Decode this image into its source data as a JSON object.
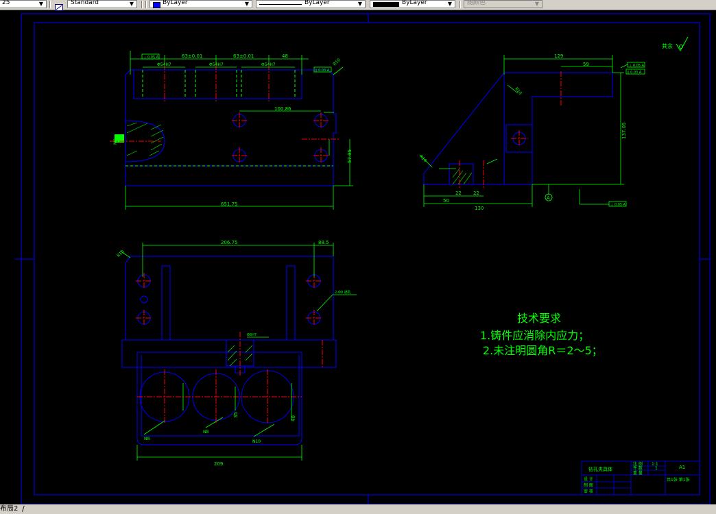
{
  "toolbar": {
    "lineweight_value": "25",
    "dimstyle_value": "Standard",
    "color_value": "ByLayer",
    "color_hex": "#0000ff",
    "linetype_value": "ByLayer",
    "lineweight2_value": "ByLayer",
    "plotstyle_value": "随颜色"
  },
  "drawing": {
    "background": "#000000",
    "colors": {
      "border": "#0000ff",
      "part": "#0000ff",
      "dimension": "#00ff00",
      "centerline": "#ff0000",
      "hidden": "#00ff00"
    },
    "roughness_note": "其余",
    "front_view": {
      "dims": [
        "63±0.01",
        "63±0.01",
        "48",
        "Φ54H7",
        "Φ54H7",
        "Φ54H7",
        "100.86",
        "651.75",
        "57.95",
        "R10",
        "M8"
      ],
      "tolerance_boxes": [
        "⊥ 0.05 A",
        "∥ 0.03 A"
      ]
    },
    "side_view": {
      "dims": [
        "129",
        "59",
        "137.05",
        "50",
        "22",
        "22",
        "130",
        "R10",
        "R18"
      ],
      "datum": "A",
      "tolerance_boxes": [
        "⊥ 0.05 A",
        "∥ 0.03 A",
        "⊥ 0.05 A"
      ]
    },
    "top_view": {
      "dims": [
        "206.75",
        "88.5",
        "209",
        "2-Φ9 通孔",
        "Φ8H7",
        "R10",
        "40",
        "35"
      ],
      "labels": [
        "N8",
        "N8",
        "N10"
      ]
    },
    "tech_requirements": {
      "title": "技术要求",
      "items": [
        "1.铸件应消除内应力；",
        "2.未注明圆角R＝2～5；"
      ]
    },
    "title_block": {
      "part_name": "钻孔夹具体",
      "ratio_label": "比 例",
      "ratio_value": "1:1",
      "qty_label": "件 数",
      "qty_value": "1",
      "weight_label": "重 量",
      "sheet_size": "A1",
      "sheet_info": "共1张 第1张",
      "design_label": "设 计",
      "draw_label": "制 图",
      "review_label": "审 核"
    }
  },
  "status": {
    "layout_tab": "布局2"
  }
}
